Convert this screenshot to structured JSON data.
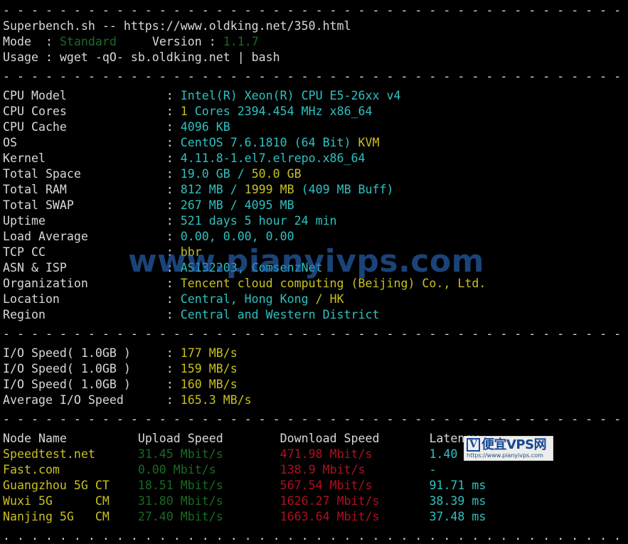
{
  "terminal": {
    "separator": "- - - - - - - - - - - - - - - - - - - - - - - - - - - - - - - - - - - - - - - - - - - - - - -",
    "separator_dot": ". . . . . . . . . . . . . . . . . . . . . . . . . . . . . . . . . . . . . . . . . . . . . . . . . . . .",
    "background_color": "#000000",
    "foreground_color": "#d8d8d8",
    "colors": {
      "cyan": "#2fc0c0",
      "yellow": "#c8c020",
      "green": "#186b22",
      "red": "#b01020",
      "white": "#d8d8d8",
      "watermark_blue": "#2d6cc4",
      "logo_blue": "#1a4fa0"
    }
  },
  "header": {
    "title": "Superbench.sh -- https://www.oldking.net/350.html",
    "mode_label": "Mode  : ",
    "mode_value": "Standard",
    "version_label": "     Version : ",
    "version_value": "1.1.7",
    "usage_label": "Usage : ",
    "usage_value": "wget -qO- sb.oldking.net | bash"
  },
  "sysinfo": [
    {
      "label": "CPU Model",
      "parts": [
        {
          "text": "Intel(R) Xeon(R) CPU E5-26xx v4",
          "color": "cyan"
        }
      ]
    },
    {
      "label": "CPU Cores",
      "parts": [
        {
          "text": "1",
          "color": "yellow"
        },
        {
          "text": " Cores ",
          "color": "cyan"
        },
        {
          "text": "2394.454",
          "color": "cyan"
        },
        {
          "text": " MHz ",
          "color": "cyan"
        },
        {
          "text": "x86_64",
          "color": "cyan"
        }
      ]
    },
    {
      "label": "CPU Cache",
      "parts": [
        {
          "text": "4096 KB",
          "color": "cyan"
        }
      ]
    },
    {
      "label": "OS",
      "parts": [
        {
          "text": "CentOS 7.6.1810 (64 Bit) ",
          "color": "cyan"
        },
        {
          "text": "KVM",
          "color": "yellow"
        }
      ]
    },
    {
      "label": "Kernel",
      "parts": [
        {
          "text": "4.11.8-1.el7.elrepo.x86_64",
          "color": "cyan"
        }
      ]
    },
    {
      "label": "Total Space",
      "parts": [
        {
          "text": "19.0 GB",
          "color": "cyan"
        },
        {
          "text": " / ",
          "color": "cyan"
        },
        {
          "text": "50.0 GB",
          "color": "yellow"
        }
      ]
    },
    {
      "label": "Total RAM",
      "parts": [
        {
          "text": "812 MB",
          "color": "cyan"
        },
        {
          "text": " / ",
          "color": "cyan"
        },
        {
          "text": "1999 MB",
          "color": "yellow"
        },
        {
          "text": " (409 MB Buff)",
          "color": "cyan"
        }
      ]
    },
    {
      "label": "Total SWAP",
      "parts": [
        {
          "text": "267 MB / 4095 MB",
          "color": "cyan"
        }
      ]
    },
    {
      "label": "Uptime",
      "parts": [
        {
          "text": "521 days 5 hour 24 min",
          "color": "cyan"
        }
      ]
    },
    {
      "label": "Load Average",
      "parts": [
        {
          "text": "0.00, 0.00, 0.00",
          "color": "cyan"
        }
      ]
    },
    {
      "label": "TCP CC",
      "parts": [
        {
          "text": "bbr",
          "color": "yellow"
        }
      ]
    },
    {
      "label": "ASN & ISP",
      "parts": [
        {
          "text": "AS132203",
          "color": "cyan"
        },
        {
          "text": ", ",
          "color": "cyan"
        },
        {
          "text": "ComsenzNet",
          "color": "cyan"
        }
      ]
    },
    {
      "label": "Organization",
      "parts": [
        {
          "text": "Tencent cloud computing (Beijing) Co., Ltd.",
          "color": "yellow"
        }
      ]
    },
    {
      "label": "Location",
      "parts": [
        {
          "text": "Central, Hong Kong ",
          "color": "cyan"
        },
        {
          "text": "/ HK",
          "color": "yellow"
        }
      ]
    },
    {
      "label": "Region",
      "parts": [
        {
          "text": "Central and Western District",
          "color": "cyan"
        }
      ]
    }
  ],
  "io": [
    {
      "label": "I/O Speed( 1.0GB )",
      "value": "177 MB/s"
    },
    {
      "label": "I/O Speed( 1.0GB )",
      "value": "159 MB/s"
    },
    {
      "label": "I/O Speed( 1.0GB )",
      "value": "160 MB/s"
    },
    {
      "label": "Average I/O Speed",
      "value": "165.3 MB/s"
    }
  ],
  "speedtest": {
    "headers": {
      "node": "Node Name",
      "upload": "Upload Speed",
      "download": "Download Speed",
      "latency": "Latency"
    },
    "rows": [
      {
        "node": "Speedtest.net",
        "upload": "31.45 Mbit/s",
        "download": "471.98 Mbit/s",
        "latency": "1.40 ms"
      },
      {
        "node": "Fast.com",
        "upload": "0.00 Mbit/s",
        "download": "138.9 Mbit/s",
        "latency": "-"
      },
      {
        "node": "Guangzhou 5G CT",
        "upload": "18.51 Mbit/s",
        "download": "567.54 Mbit/s",
        "latency": "91.71 ms"
      },
      {
        "node": "Wuxi 5G      CM",
        "upload": "31.80 Mbit/s",
        "download": "1626.27 Mbit/s",
        "latency": "38.39 ms"
      },
      {
        "node": "Nanjing 5G   CM",
        "upload": "27.40 Mbit/s",
        "download": "1663.64 Mbit/s",
        "latency": "37.48 ms"
      }
    ]
  },
  "watermark": {
    "text": "www.pianyivps.com",
    "logo_v": "V",
    "logo_cn": "便宜VPS网",
    "logo_url": "https://www.pianyivps.com"
  }
}
